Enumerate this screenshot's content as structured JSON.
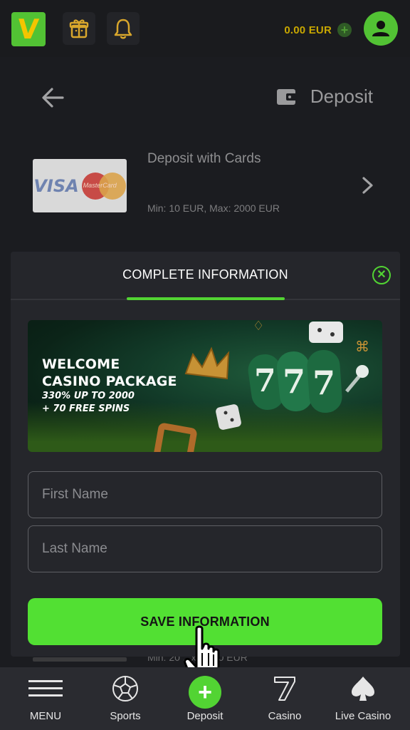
{
  "header": {
    "logo_text": "V",
    "balance": "0.00 EUR",
    "balance_add": "+"
  },
  "deposit_page": {
    "title": "Deposit",
    "method_title": "Deposit with Cards",
    "visa_text": "VISA",
    "mastercard_text": "MasterCard",
    "limits": "Min: 10 EUR,  Max: 2000 EUR",
    "second_row_limits_partial": "Min: 20 ...x: 2000 EUR"
  },
  "modal": {
    "title": "COMPLETE INFORMATION",
    "close_icon": "close-circle-icon",
    "banner": {
      "title_line1": "WELCOME",
      "title_line2": "CASINO PACKAGE",
      "sub_line1": "330% UP TO 2000",
      "sub_line2": "+ 70 FREE SPINS"
    },
    "first_name_placeholder": "First Name",
    "last_name_placeholder": "Last Name",
    "save_label": "SAVE INFORMATION"
  },
  "bottom_nav": {
    "menu": "MENU",
    "sports": "Sports",
    "deposit": "Deposit",
    "casino": "Casino",
    "live_casino": "Live Casino"
  },
  "colors": {
    "accent_green": "#52d433",
    "button_green": "#52e033",
    "balance_gold": "#c8a700",
    "background": "#1c1d21"
  }
}
